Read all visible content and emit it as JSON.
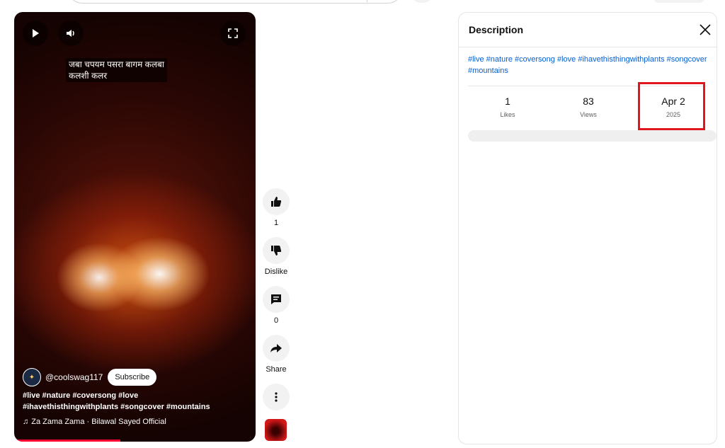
{
  "video": {
    "overlay_line1": "जबा चपयम पसरा बागम कलबा",
    "overlay_line2": "कलशी कलर",
    "channel_handle": "@coolswag117",
    "subscribe_label": "Subscribe",
    "description": "#live #nature #coversong #love #ihavethisthingwithplants #songcover #mountains",
    "music": "Za Zama Zama · Bilawal Sayed Official",
    "progress_fraction": 0.44
  },
  "actions": {
    "like_count": "1",
    "dislike_label": "Dislike",
    "comment_count": "0",
    "share_label": "Share"
  },
  "panel": {
    "title": "Description",
    "tags": "#live #nature #coversong #love #ihavethisthingwithplants #songcover #mountains",
    "stats": [
      {
        "value": "1",
        "label": "Likes"
      },
      {
        "value": "83",
        "label": "Views"
      },
      {
        "value": "Apr 2",
        "label": "2025"
      }
    ]
  },
  "colors": {
    "accent_red": "#ff0033",
    "highlight_red": "#e0161f",
    "link_blue": "#065fd4"
  }
}
